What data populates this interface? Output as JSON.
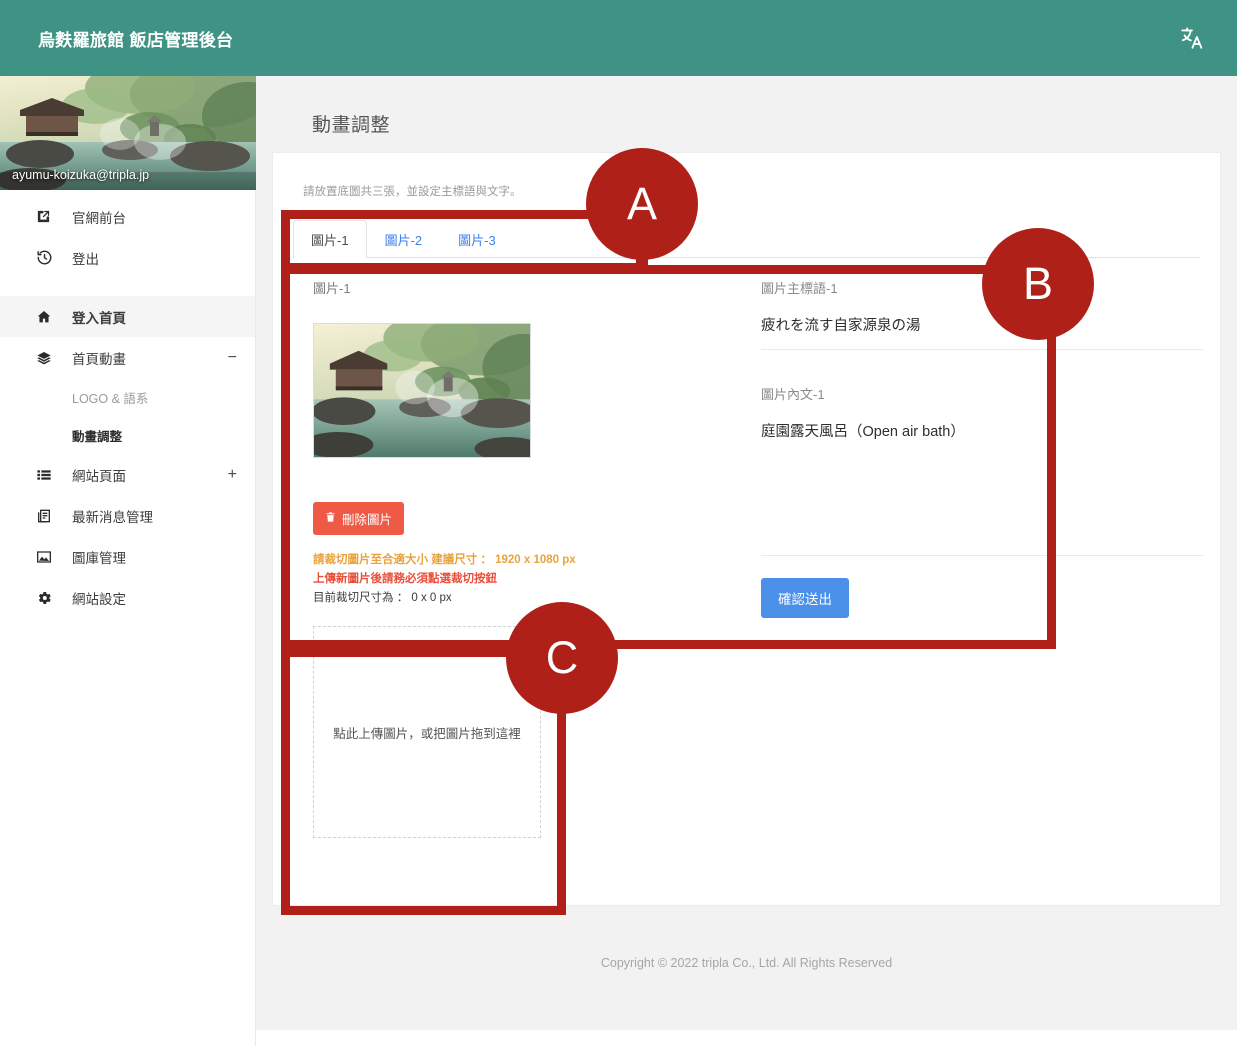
{
  "topbar": {
    "title": "烏麩羅旅館 飯店管理後台",
    "lang_icon": "translate-icon",
    "bg_color": "#3E9384"
  },
  "sidebar": {
    "profile": {
      "email": "ayumu-koizuka@tripla.jp"
    },
    "quick_links": [
      {
        "label": "官網前台",
        "icon": "external-link-icon"
      },
      {
        "label": "登出",
        "icon": "history-logout-icon"
      }
    ],
    "items": [
      {
        "label": "登入首頁",
        "icon": "home-icon",
        "active": true,
        "suffix": ""
      },
      {
        "label": "首頁動畫",
        "icon": "layers-icon",
        "active": false,
        "suffix": "−"
      },
      {
        "label": "網站頁面",
        "icon": "list-icon",
        "active": false,
        "suffix": "+"
      },
      {
        "label": "最新消息管理",
        "icon": "news-icon",
        "active": false,
        "suffix": ""
      },
      {
        "label": "圖庫管理",
        "icon": "image-icon",
        "active": false,
        "suffix": ""
      },
      {
        "label": "網站設定",
        "icon": "gear-icon",
        "active": false,
        "suffix": ""
      }
    ],
    "sub_items": [
      {
        "label": "LOGO & 語系",
        "current": false
      },
      {
        "label": "動畫調整",
        "current": true
      }
    ]
  },
  "main": {
    "page_title": "動畫調整",
    "card_hint": "請放置底圖共三張，並設定主標語與文字。",
    "tabs": [
      {
        "label": "圖片-1",
        "active": true
      },
      {
        "label": "圖片-2",
        "active": false
      },
      {
        "label": "圖片-3",
        "active": false
      }
    ],
    "left": {
      "image_label": "圖片-1",
      "delete_button": "刪除圖片",
      "delete_icon": "trash-icon",
      "warn_crop": "請裁切圖片至合適大小 建議尺寸 ： 1920 x 1080 px",
      "warn_must": "上傳新圖片後請務必須點選裁切按鈕",
      "current_size": "目前裁切尺寸為 ： 0 x 0 px"
    },
    "right": {
      "headline_label": "圖片主標語-1",
      "headline_value": "疲れを流す自家源泉の湯",
      "body_label": "圖片內文-1",
      "body_value": "庭園露天風呂（Open air bath）",
      "submit_label": "確認送出"
    },
    "dropzone": {
      "text": "點此上傳圖片，或把圖片拖到這裡"
    },
    "footer": "Copyright © 2022 tripla Co., Ltd. All Rights Reserved"
  },
  "annotations": {
    "color": "#AF2018",
    "markers": [
      {
        "id": "A",
        "label": "A"
      },
      {
        "id": "B",
        "label": "B"
      },
      {
        "id": "C",
        "label": "C"
      }
    ]
  }
}
